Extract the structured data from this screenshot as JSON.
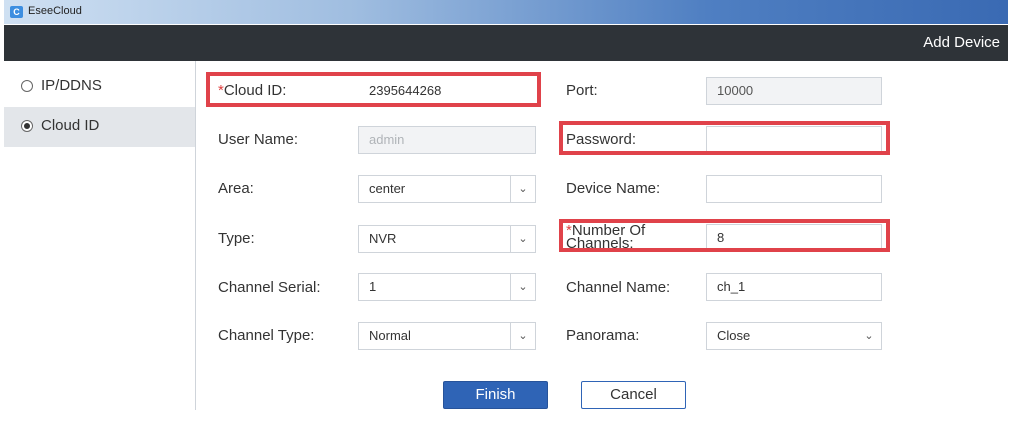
{
  "window": {
    "app_title": "EseeCloud",
    "app_icon": "eseecloud-logo-icon"
  },
  "header": {
    "title": "Add Device"
  },
  "sidebar": {
    "items": [
      {
        "label": "IP/DDNS",
        "selected": false
      },
      {
        "label": "Cloud ID",
        "selected": true
      }
    ]
  },
  "form": {
    "cloud_id": {
      "label": "Cloud ID:",
      "required_mark": "*",
      "value": "2395644268"
    },
    "port": {
      "label": "Port:",
      "value": "10000"
    },
    "user_name": {
      "label": "User Name:",
      "value": "admin"
    },
    "password": {
      "label": "Password:",
      "value": ""
    },
    "area": {
      "label": "Area:",
      "value": "center"
    },
    "device_name": {
      "label": "Device Name:",
      "value": ""
    },
    "type": {
      "label": "Type:",
      "value": "NVR"
    },
    "number_of_channels": {
      "label": "Number Of Channels:",
      "required_mark": "*",
      "value": "8"
    },
    "channel_serial": {
      "label": "Channel Serial:",
      "value": "1"
    },
    "channel_name": {
      "label": "Channel Name:",
      "value": "ch_1"
    },
    "channel_type": {
      "label": "Channel Type:",
      "value": "Normal"
    },
    "panorama": {
      "label": "Panorama:",
      "value": "Close"
    }
  },
  "buttons": {
    "finish": "Finish",
    "cancel": "Cancel"
  },
  "colors": {
    "header_bg": "#2e3338",
    "highlight": "#e0424a",
    "primary": "#2f64b6"
  }
}
